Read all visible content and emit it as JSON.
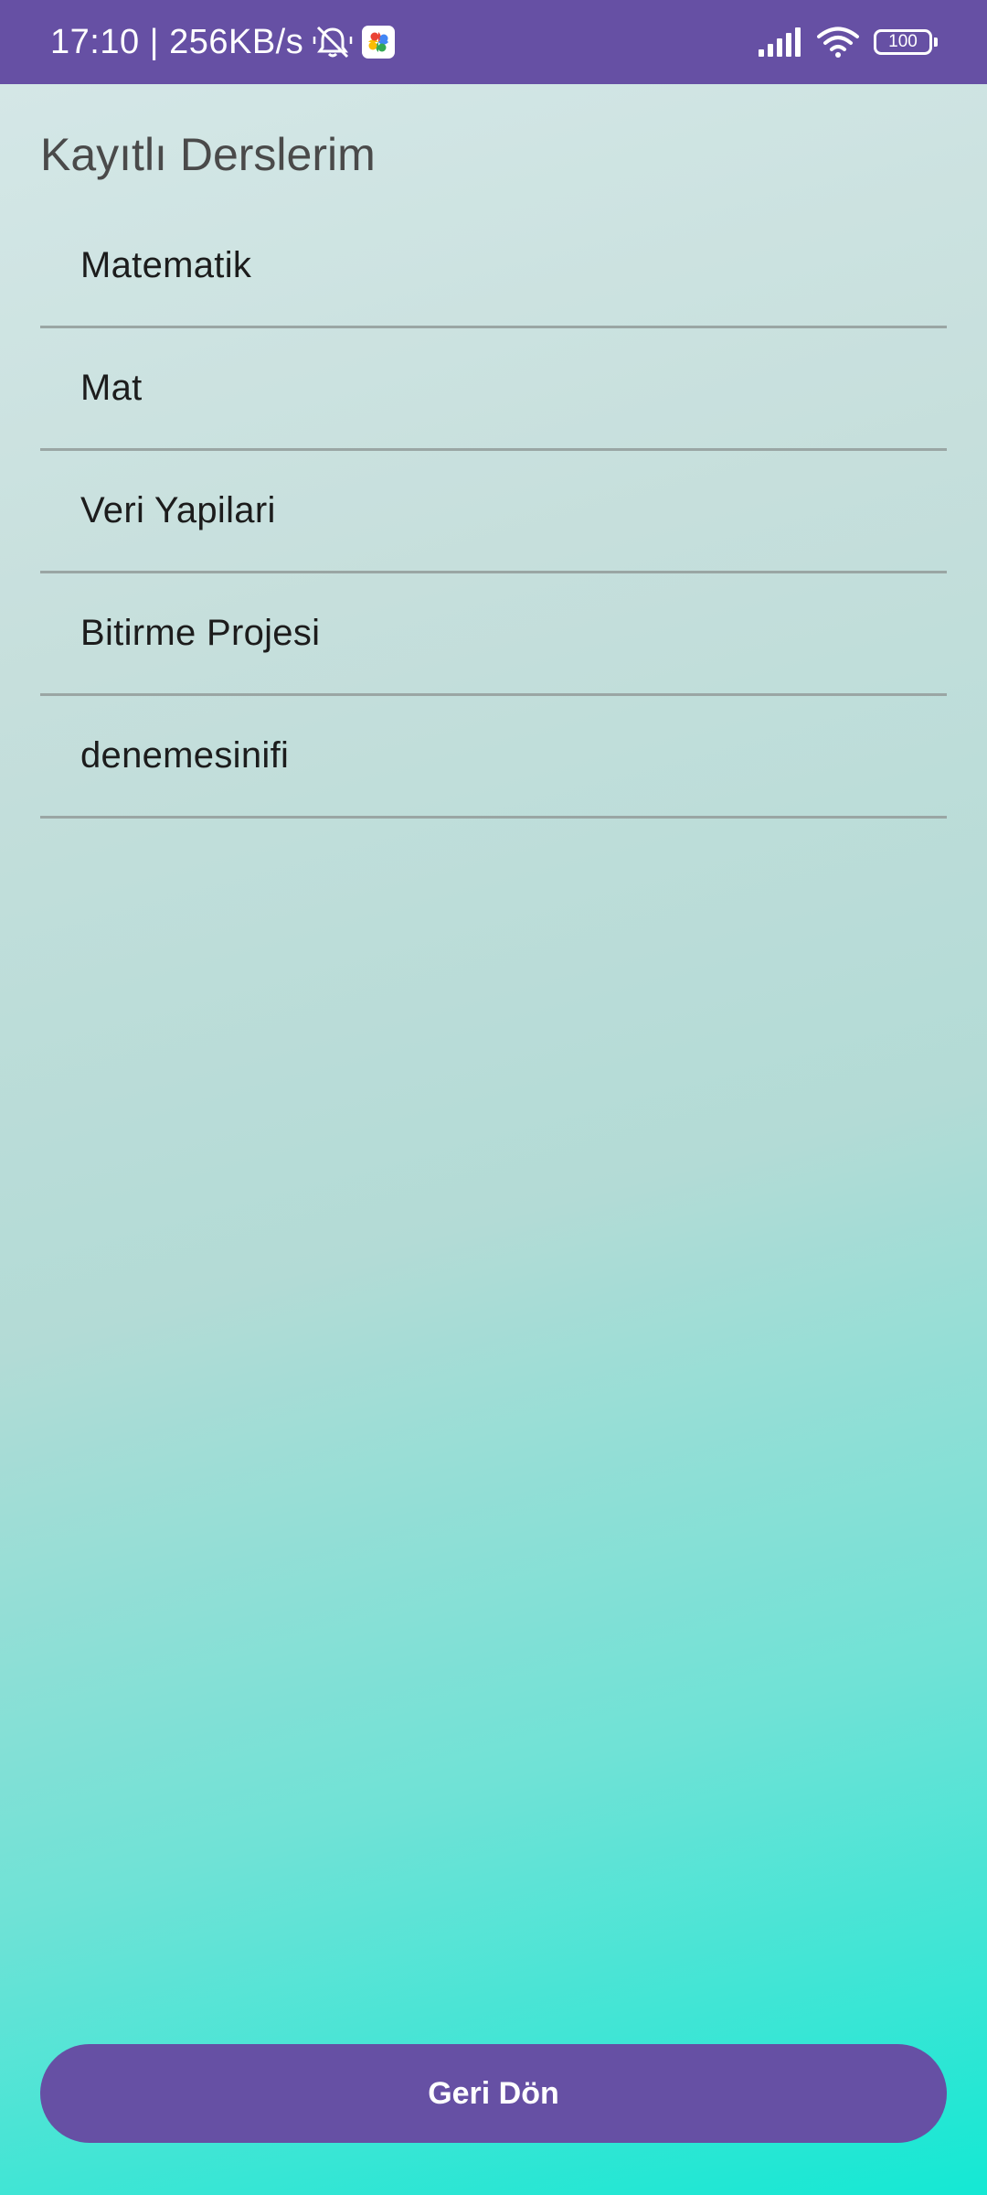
{
  "status_bar": {
    "time_speed": "17:10 | 256KB/s",
    "battery_level": "100",
    "icons": [
      "alarm-off-icon",
      "google-photos-icon",
      "signal-icon",
      "wifi-icon",
      "battery-icon"
    ]
  },
  "page": {
    "title": "Kayıtlı Derslerim"
  },
  "courses": [
    {
      "label": "Matematik"
    },
    {
      "label": "Mat"
    },
    {
      "label": "Veri Yapilari"
    },
    {
      "label": "Bitirme Projesi"
    },
    {
      "label": "denemesinifi"
    }
  ],
  "actions": {
    "back_label": "Geri Dön"
  },
  "colors": {
    "primary": "#6650a4",
    "background_top": "#d6e8e8",
    "background_bottom": "#14e8d4"
  }
}
